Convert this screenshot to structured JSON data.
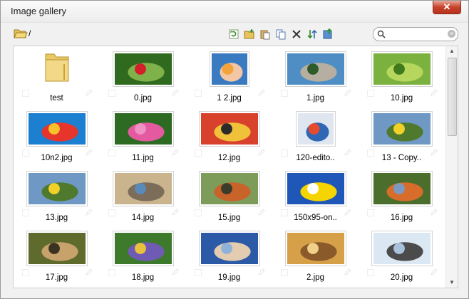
{
  "window": {
    "title": "Image gallery",
    "close_label": "✕"
  },
  "toolbar": {
    "path": "/",
    "tools": [
      "refresh-icon",
      "new-folder-icon",
      "paste-icon",
      "copy-icon",
      "delete-icon",
      "sort-icon",
      "upload-icon"
    ],
    "search": {
      "value": "",
      "placeholder": ""
    }
  },
  "items": [
    {
      "name": "test",
      "kind": "folder"
    },
    {
      "name": "0.jpg",
      "kind": "image",
      "colors": [
        "#2f6a1e",
        "#7fb24a",
        "#d21f2a"
      ]
    },
    {
      "name": "1 2.jpg",
      "kind": "image",
      "colors": [
        "#3a7ac0",
        "#f3c7a5",
        "#f2a33a"
      ]
    },
    {
      "name": "1.jpg",
      "kind": "image",
      "colors": [
        "#4f8ec4",
        "#b6aea0",
        "#2e5b2a"
      ]
    },
    {
      "name": "10.jpg",
      "kind": "image",
      "colors": [
        "#7bb13e",
        "#b7d65e",
        "#3f7a1c"
      ]
    },
    {
      "name": "10n2.jpg",
      "kind": "image",
      "colors": [
        "#1c7fd0",
        "#e7352b",
        "#f6c12a"
      ]
    },
    {
      "name": "11.jpg",
      "kind": "image",
      "colors": [
        "#2e6b22",
        "#e45aa0",
        "#f091c4"
      ]
    },
    {
      "name": "12.jpg",
      "kind": "image",
      "colors": [
        "#d8412c",
        "#f0c23a",
        "#2b2b2b"
      ]
    },
    {
      "name": "120-edito..",
      "kind": "image",
      "colors": [
        "#dfe6ef",
        "#2f67b5",
        "#e64b2c"
      ]
    },
    {
      "name": "13 - Copy..",
      "kind": "image",
      "colors": [
        "#6f99c4",
        "#4f7a2d",
        "#f0d12a"
      ]
    },
    {
      "name": "13.jpg",
      "kind": "image",
      "colors": [
        "#6f99c4",
        "#4f7a2d",
        "#f0d12a"
      ]
    },
    {
      "name": "14.jpg",
      "kind": "image",
      "colors": [
        "#c9b48e",
        "#7c6d5a",
        "#5a8ab8"
      ]
    },
    {
      "name": "15.jpg",
      "kind": "image",
      "colors": [
        "#7d9c5a",
        "#c8632a",
        "#3b3b2b"
      ]
    },
    {
      "name": "150x95-on..",
      "kind": "image",
      "colors": [
        "#1e57b8",
        "#f6d400",
        "#ffffff"
      ]
    },
    {
      "name": "16.jpg",
      "kind": "image",
      "colors": [
        "#4b6e2c",
        "#d86c2a",
        "#7b9ac2"
      ]
    },
    {
      "name": "17.jpg",
      "kind": "image",
      "colors": [
        "#5f6b2c",
        "#c7a26a",
        "#3b3321"
      ]
    },
    {
      "name": "18.jpg",
      "kind": "image",
      "colors": [
        "#3e7a2b",
        "#6f5bb4",
        "#e8c23a"
      ]
    },
    {
      "name": "19.jpg",
      "kind": "image",
      "colors": [
        "#2c5aa6",
        "#e3ccb0",
        "#8fb2d8"
      ]
    },
    {
      "name": "2.jpg",
      "kind": "image",
      "colors": [
        "#d6a048",
        "#8a5a2a",
        "#f0d08a"
      ]
    },
    {
      "name": "20.jpg",
      "kind": "image",
      "colors": [
        "#dbe7f3",
        "#4b4b4b",
        "#a9c2dc"
      ]
    }
  ]
}
